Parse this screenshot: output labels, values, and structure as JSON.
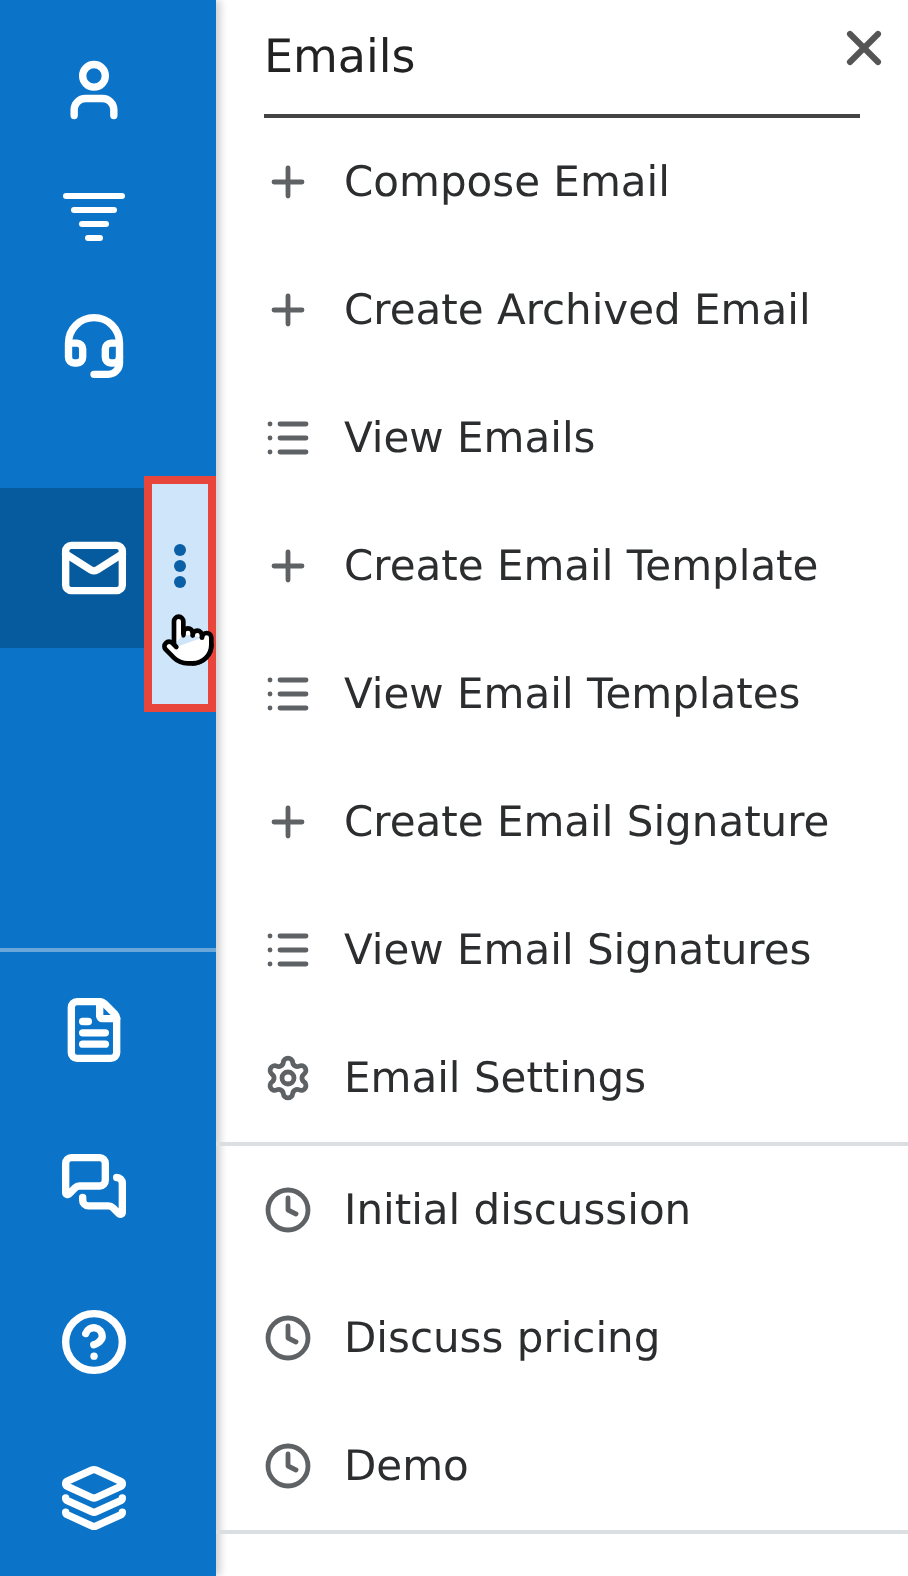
{
  "sidebar": {
    "top_items": [
      {
        "kind": "user",
        "selected": false
      },
      {
        "kind": "funnel",
        "selected": false
      },
      {
        "kind": "headset",
        "selected": false
      },
      {
        "kind": "mail",
        "selected": true
      }
    ],
    "bottom_items": [
      {
        "kind": "document"
      },
      {
        "kind": "chat"
      },
      {
        "kind": "help"
      },
      {
        "kind": "layers"
      }
    ],
    "more_button": {
      "highlighted": true
    }
  },
  "menu": {
    "title": "Emails",
    "sections": [
      [
        {
          "kind": "plus",
          "label": "Compose Email"
        },
        {
          "kind": "plus",
          "label": "Create Archived Email"
        },
        {
          "kind": "list",
          "label": "View Emails"
        },
        {
          "kind": "plus",
          "label": "Create Email Template"
        },
        {
          "kind": "list",
          "label": "View Email Templates"
        },
        {
          "kind": "plus",
          "label": "Create Email Signature"
        },
        {
          "kind": "list",
          "label": "View Email Signatures"
        },
        {
          "kind": "gear",
          "label": "Email Settings"
        }
      ],
      [
        {
          "kind": "clock",
          "label": "Initial discussion"
        },
        {
          "kind": "clock",
          "label": "Discuss pricing"
        },
        {
          "kind": "clock",
          "label": "Demo"
        }
      ]
    ]
  }
}
